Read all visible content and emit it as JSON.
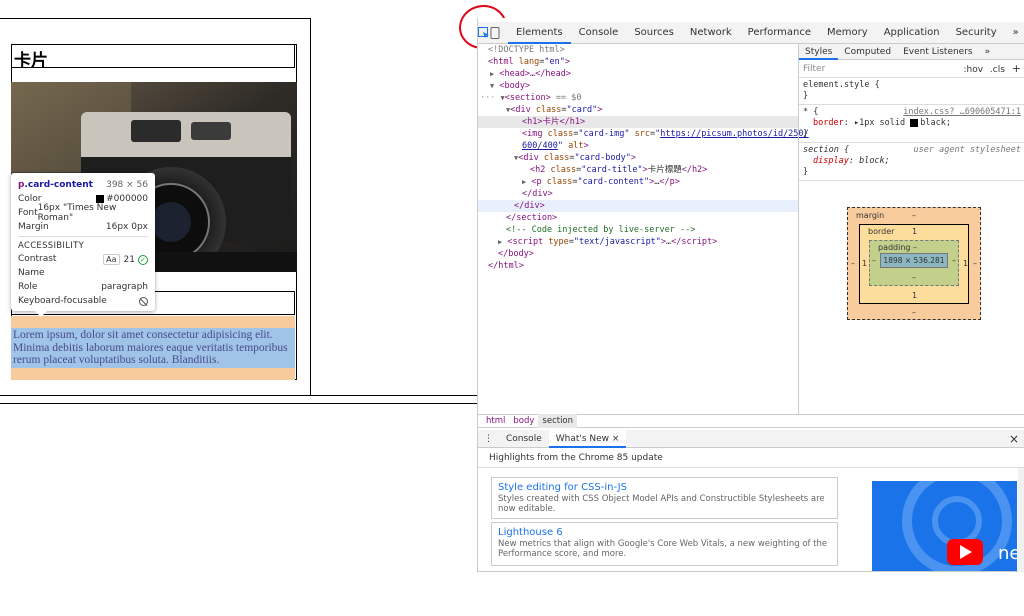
{
  "page": {
    "h1": "卡片",
    "card_content": "Lorem ipsum, dolor sit amet consectetur adipisicing elit. Minima debitis laborum maiores eaque veritatis temporibus rerum placeat voluptatibus soluta. Blanditiis."
  },
  "tooltip": {
    "selector_tag": "p",
    "selector_class": ".card-content",
    "size": "398 × 56",
    "rows": [
      {
        "label": "Color",
        "value": "#000000"
      },
      {
        "label": "Font",
        "value": "16px \"Times New Roman\""
      },
      {
        "label": "Margin",
        "value": "16px 0px"
      }
    ],
    "accessibility_heading": "ACCESSIBILITY",
    "contrast_label": "Contrast",
    "contrast_aa": "Aa",
    "contrast_value": "21",
    "name_label": "Name",
    "role_label": "Role",
    "role_value": "paragraph",
    "focusable_label": "Keyboard-focusable"
  },
  "devtools": {
    "tabs": [
      "Elements",
      "Console",
      "Sources",
      "Network",
      "Performance",
      "Memory",
      "Application",
      "Security"
    ],
    "more": "»",
    "dom": {
      "doctype": "<!DOCTYPE html>",
      "html_open_tag": "html",
      "html_lang_attr": "lang",
      "html_lang_val": "\"en\"",
      "head": "<head>…</head>",
      "body": "<body>",
      "section_open": "<section>",
      "section_eq": " == $0",
      "div_card_tag": "div",
      "div_card_attr": "class",
      "div_card_val": "\"card\"",
      "h1_line": "<h1>卡片</h1>",
      "img_tag": "img",
      "img_class_attr": "class",
      "img_class_val": "\"card-img\"",
      "img_src_attr": "src",
      "img_src_val_1": "https://picsum.photos/id/250/",
      "img_src_val_2": "600/400",
      "img_alt": "alt",
      "div_body_tag": "div",
      "div_body_attr": "class",
      "div_body_val": "\"card-body\"",
      "h2_tag": "h2",
      "h2_attr": "class",
      "h2_val": "\"card-title\"",
      "h2_text": "卡片標題",
      "p_tag": "p",
      "p_attr": "class",
      "p_val": "\"card-content\"",
      "p_ellipsis": "…",
      "div_close": "</div>",
      "section_close": "</section>",
      "comment": "<!-- Code injected by live-server -->",
      "script_tag": "script",
      "script_attr": "type",
      "script_val": "\"text/javascript\"",
      "script_ellipsis": "…",
      "body_close": "</body>",
      "html_close": "</html>"
    },
    "styles": {
      "tabs": [
        "Styles",
        "Computed",
        "Event Listeners"
      ],
      "filter_placeholder": "Filter",
      "hov": ":hov",
      "cls": ".cls",
      "plus": "+",
      "element_style": "element.style {",
      "close_brace": "}",
      "rule1_selector": "* {",
      "rule1_source": "index.css? …690605471:1",
      "rule1_prop": "border",
      "rule1_val": "1px solid",
      "rule1_val2": "black;",
      "rule2_selector": "section {",
      "rule2_source": "user agent stylesheet",
      "rule2_prop": "display",
      "rule2_val": "block;"
    },
    "box_model": {
      "margin_label": "margin",
      "margin_top": "–",
      "margin_bottom": "–",
      "margin_left": "–",
      "margin_right": "–",
      "border_label": "border",
      "border_top": "1",
      "border_bottom": "1",
      "border_left": "1",
      "border_right": "1",
      "padding_label": "padding –",
      "padding_bottom": "–",
      "padding_left": "–",
      "padding_right": "–",
      "content": "1898 × 536.281"
    },
    "breadcrumbs": [
      "html",
      "body",
      "section"
    ],
    "drawer": {
      "tabs": [
        "Console",
        "What's New"
      ],
      "close": "×",
      "headline": "Highlights from the Chrome 85 update",
      "cards": [
        {
          "title": "Style editing for CSS-in-JS",
          "desc": "Styles created with CSS Object Model APIs and Constructible Stylesheets are now editable."
        },
        {
          "title": "Lighthouse 6",
          "desc": "New metrics that align with Google's Core Web Vitals, a new weighting of the Performance score, and more."
        }
      ],
      "promo_text": "ne"
    },
    "colors": {
      "accent": "#1a73e8",
      "tag": "#881280",
      "attr": "#994500",
      "value": "#1a1aa6",
      "annotation_circle": "#e0061a"
    }
  }
}
